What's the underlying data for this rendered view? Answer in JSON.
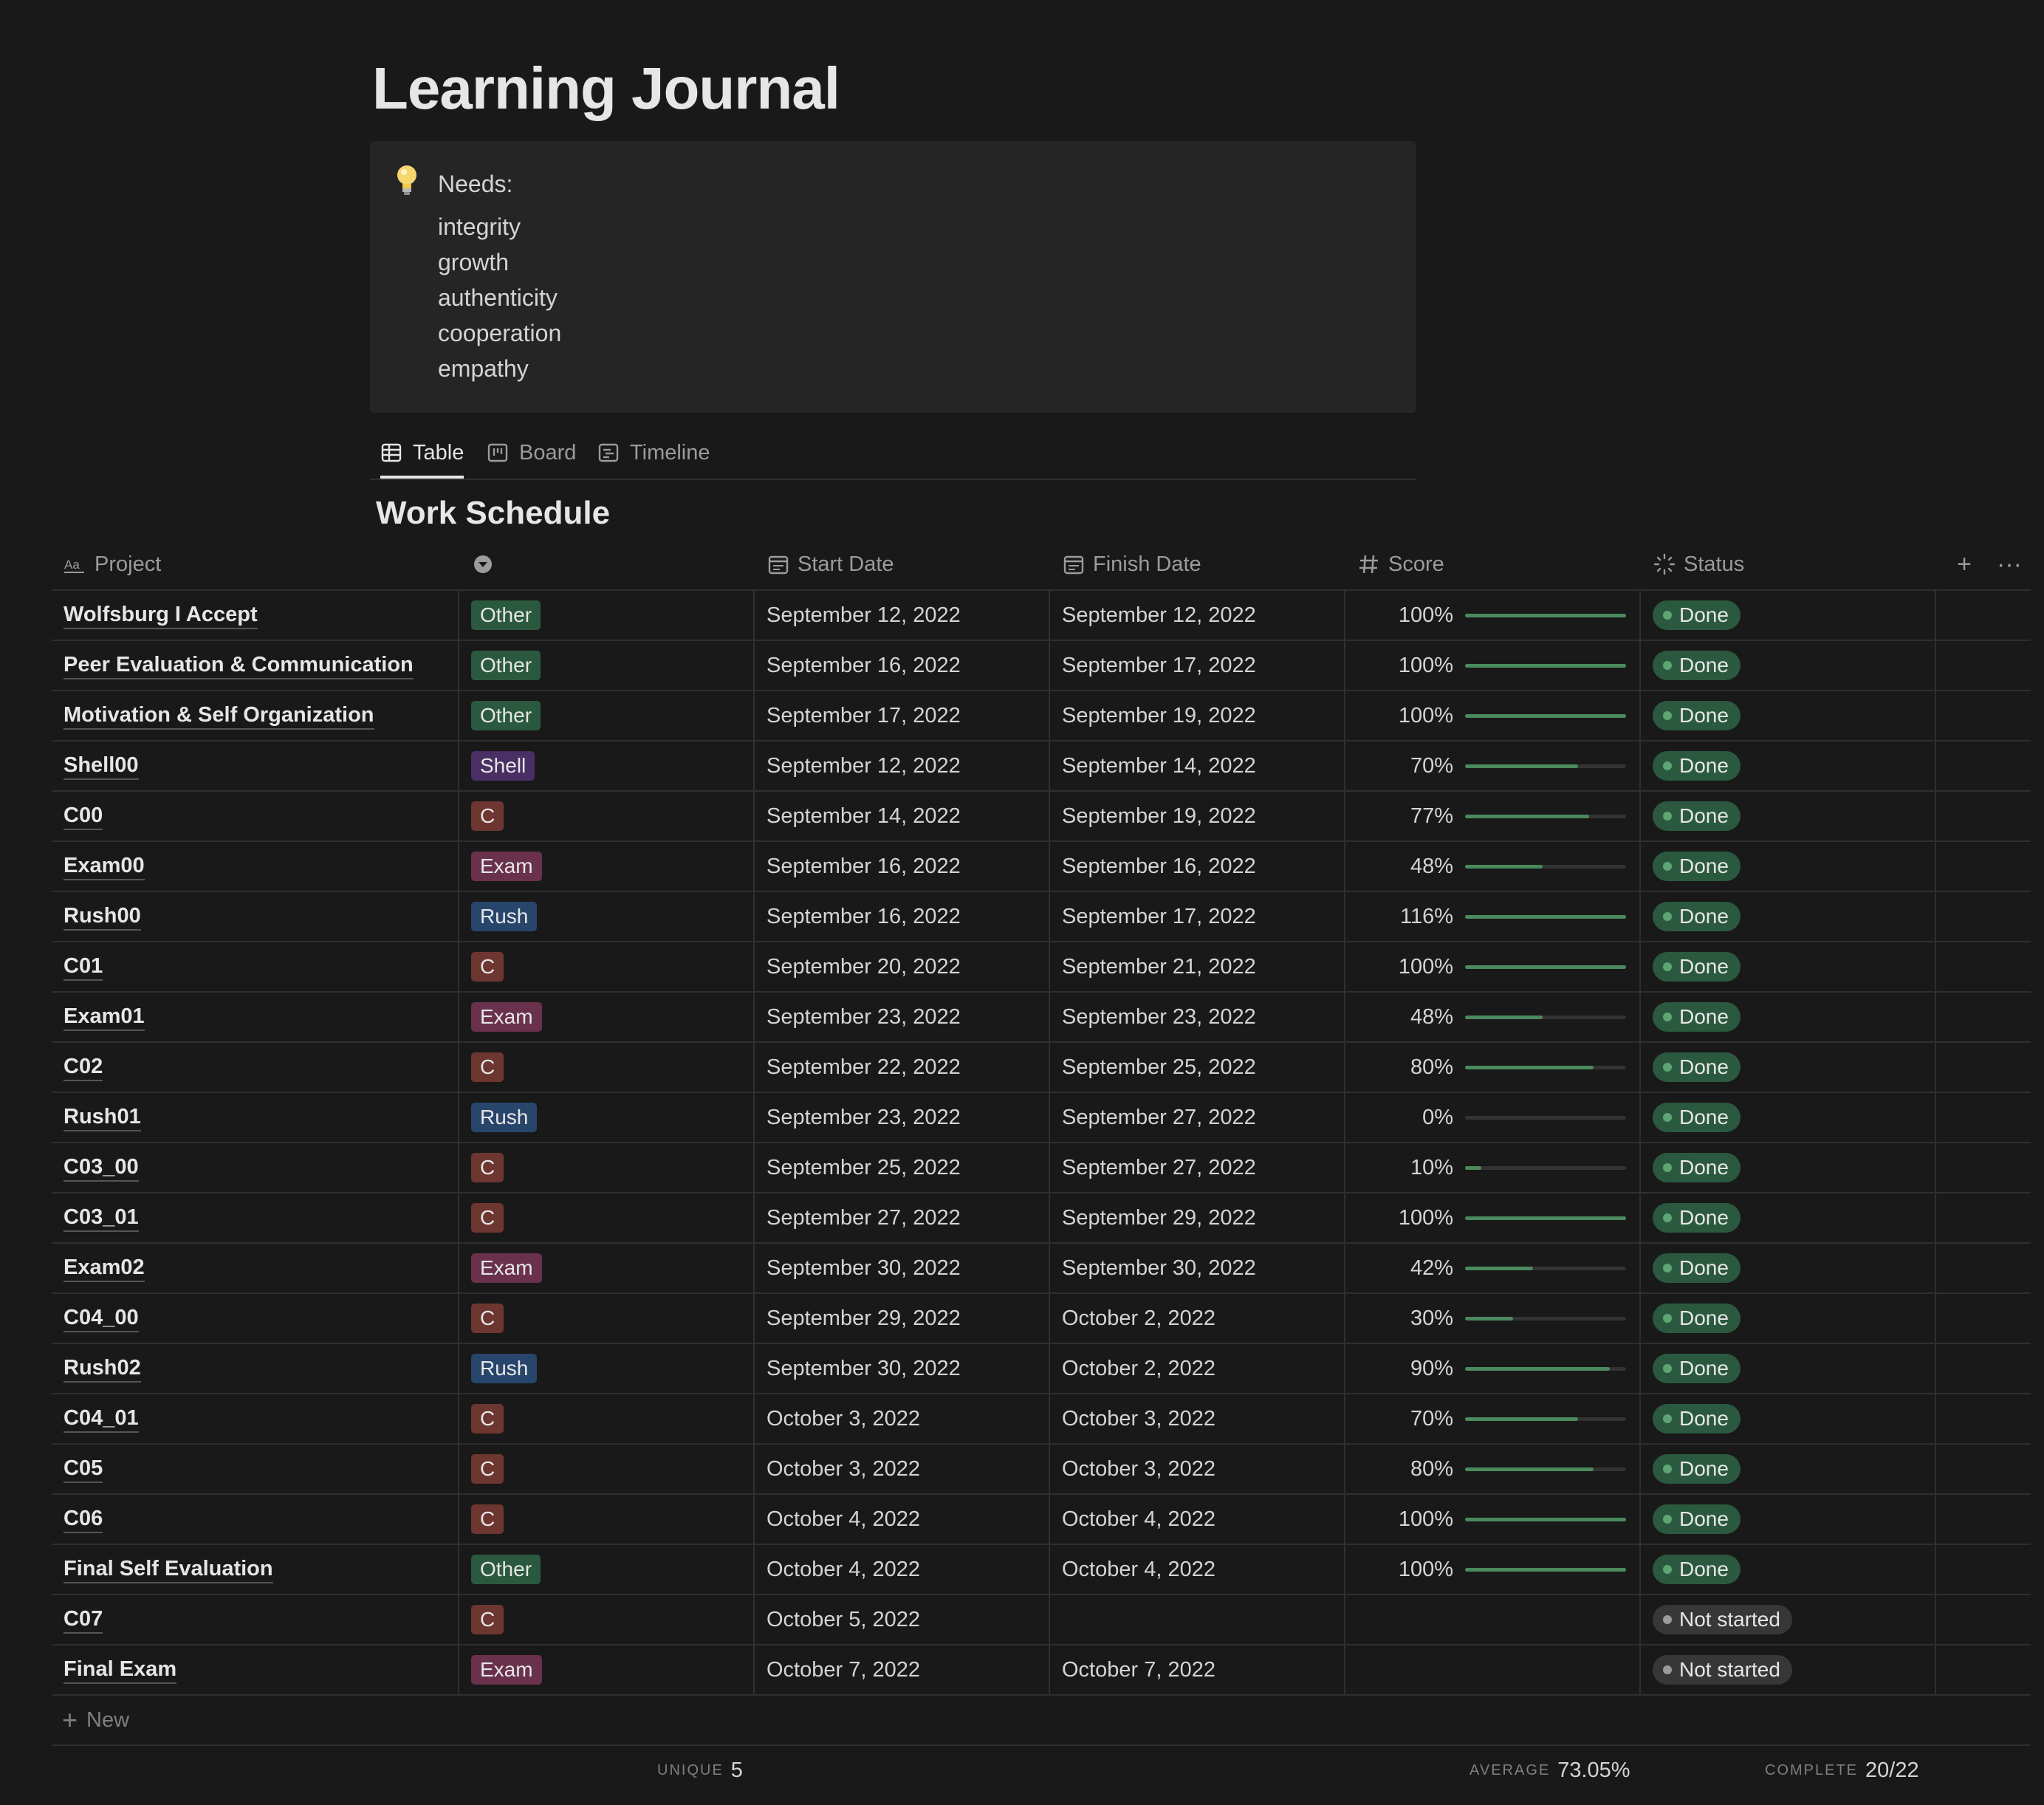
{
  "page": {
    "title": "Learning Journal"
  },
  "callout": {
    "icon": "lightbulb-icon",
    "heading": "Needs:",
    "items": [
      "integrity",
      "growth",
      "authenticity",
      "cooperation",
      "empathy"
    ]
  },
  "views": {
    "tabs": [
      {
        "label": "Table",
        "icon": "table-icon",
        "active": true
      },
      {
        "label": "Board",
        "icon": "board-icon",
        "active": false
      },
      {
        "label": "Timeline",
        "icon": "timeline-icon",
        "active": false
      }
    ]
  },
  "database": {
    "title": "Work Schedule",
    "columns": {
      "project": "Project",
      "tag": "",
      "start": "Start Date",
      "finish": "Finish Date",
      "score": "Score",
      "status": "Status"
    },
    "tag_colors": {
      "Other": "#2b593f",
      "Shell": "#492f64",
      "C": "#6e3630",
      "Exam": "#69314c",
      "Rush": "#28456c"
    },
    "status_colors": {
      "Done": {
        "bg": "#2b593f",
        "dot": "#5ea574"
      },
      "Not started": {
        "bg": "#373737",
        "dot": "#9b9b9b"
      }
    },
    "rows": [
      {
        "project": "Wolfsburg I Accept",
        "tag": "Other",
        "start": "September 12, 2022",
        "finish": "September 12, 2022",
        "score": "100%",
        "score_fraction": 1.0,
        "status": "Done"
      },
      {
        "project": "Peer Evaluation & Communication",
        "tag": "Other",
        "start": "September 16, 2022",
        "finish": "September 17, 2022",
        "score": "100%",
        "score_fraction": 1.0,
        "status": "Done"
      },
      {
        "project": "Motivation & Self Organization",
        "tag": "Other",
        "start": "September 17, 2022",
        "finish": "September 19, 2022",
        "score": "100%",
        "score_fraction": 1.0,
        "status": "Done"
      },
      {
        "project": "Shell00",
        "tag": "Shell",
        "start": "September 12, 2022",
        "finish": "September 14, 2022",
        "score": "70%",
        "score_fraction": 0.7,
        "status": "Done"
      },
      {
        "project": "C00",
        "tag": "C",
        "start": "September 14, 2022",
        "finish": "September 19, 2022",
        "score": "77%",
        "score_fraction": 0.77,
        "status": "Done"
      },
      {
        "project": "Exam00",
        "tag": "Exam",
        "start": "September 16, 2022",
        "finish": "September 16, 2022",
        "score": "48%",
        "score_fraction": 0.48,
        "status": "Done"
      },
      {
        "project": "Rush00",
        "tag": "Rush",
        "start": "September 16, 2022",
        "finish": "September 17, 2022",
        "score": "116%",
        "score_fraction": 1.0,
        "status": "Done"
      },
      {
        "project": "C01",
        "tag": "C",
        "start": "September 20, 2022",
        "finish": "September 21, 2022",
        "score": "100%",
        "score_fraction": 1.0,
        "status": "Done"
      },
      {
        "project": "Exam01",
        "tag": "Exam",
        "start": "September 23, 2022",
        "finish": "September 23, 2022",
        "score": "48%",
        "score_fraction": 0.48,
        "status": "Done"
      },
      {
        "project": "C02",
        "tag": "C",
        "start": "September 22, 2022",
        "finish": "September 25, 2022",
        "score": "80%",
        "score_fraction": 0.8,
        "status": "Done"
      },
      {
        "project": "Rush01",
        "tag": "Rush",
        "start": "September 23, 2022",
        "finish": "September 27, 2022",
        "score": "0%",
        "score_fraction": 0.0,
        "status": "Done"
      },
      {
        "project": "C03_00",
        "tag": "C",
        "start": "September 25, 2022",
        "finish": "September 27, 2022",
        "score": "10%",
        "score_fraction": 0.1,
        "status": "Done"
      },
      {
        "project": "C03_01",
        "tag": "C",
        "start": "September 27, 2022",
        "finish": "September 29, 2022",
        "score": "100%",
        "score_fraction": 1.0,
        "status": "Done"
      },
      {
        "project": "Exam02",
        "tag": "Exam",
        "start": "September 30, 2022",
        "finish": "September 30, 2022",
        "score": "42%",
        "score_fraction": 0.42,
        "status": "Done"
      },
      {
        "project": "C04_00",
        "tag": "C",
        "start": "September 29, 2022",
        "finish": "October 2, 2022",
        "score": "30%",
        "score_fraction": 0.3,
        "status": "Done"
      },
      {
        "project": "Rush02",
        "tag": "Rush",
        "start": "September 30, 2022",
        "finish": "October 2, 2022",
        "score": "90%",
        "score_fraction": 0.9,
        "status": "Done"
      },
      {
        "project": "C04_01",
        "tag": "C",
        "start": "October 3, 2022",
        "finish": "October 3, 2022",
        "score": "70%",
        "score_fraction": 0.7,
        "status": "Done"
      },
      {
        "project": "C05",
        "tag": "C",
        "start": "October 3, 2022",
        "finish": "October 3, 2022",
        "score": "80%",
        "score_fraction": 0.8,
        "status": "Done"
      },
      {
        "project": "C06",
        "tag": "C",
        "start": "October 4, 2022",
        "finish": "October 4, 2022",
        "score": "100%",
        "score_fraction": 1.0,
        "status": "Done"
      },
      {
        "project": "Final Self Evaluation",
        "tag": "Other",
        "start": "October 4, 2022",
        "finish": "October 4, 2022",
        "score": "100%",
        "score_fraction": 1.0,
        "status": "Done"
      },
      {
        "project": "C07",
        "tag": "C",
        "start": "October 5, 2022",
        "finish": "",
        "score": "",
        "score_fraction": null,
        "status": "Not started"
      },
      {
        "project": "Final Exam",
        "tag": "Exam",
        "start": "October 7, 2022",
        "finish": "October 7, 2022",
        "score": "",
        "score_fraction": null,
        "status": "Not started"
      }
    ],
    "new_label": "New",
    "footer": {
      "unique_label": "UNIQUE",
      "unique_value": "5",
      "average_label": "AVERAGE",
      "average_value": "73.05%",
      "complete_label": "COMPLETE",
      "complete_value": "20/22"
    }
  }
}
